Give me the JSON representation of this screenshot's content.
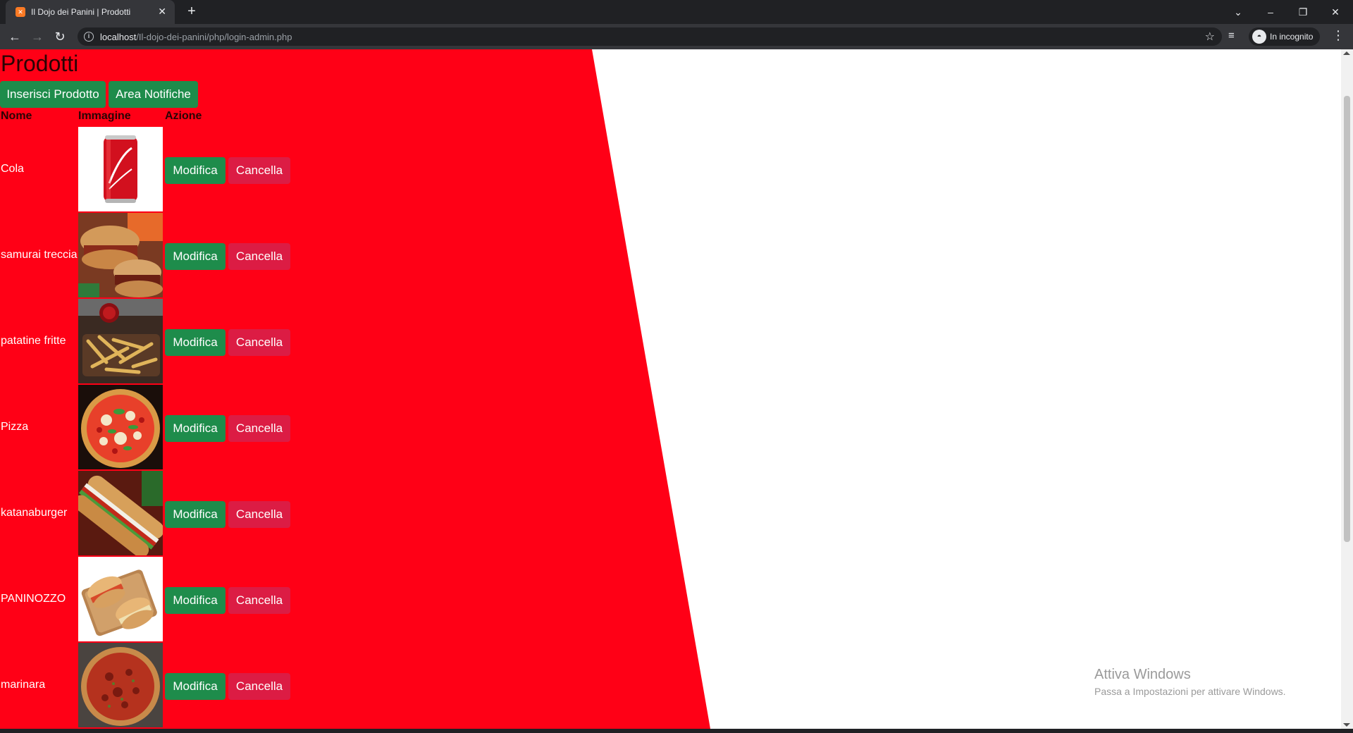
{
  "browser": {
    "tab_title": "Il Dojo dei Panini | Prodotti",
    "url_host": "localhost",
    "url_path": "/Il-dojo-dei-panini/php/login-admin.php",
    "incognito_label": "In incognito"
  },
  "page": {
    "title": "Prodotti",
    "buttons": {
      "insert": "Inserisci Prodotto",
      "notifications": "Area Notifiche"
    },
    "table": {
      "headers": [
        "Nome",
        "Immagine",
        "Azione"
      ],
      "edit_label": "Modifica",
      "delete_label": "Cancella",
      "rows": [
        {
          "name": "Cola",
          "image": "cola-can"
        },
        {
          "name": "samurai treccia",
          "image": "sandwich"
        },
        {
          "name": "patatine fritte",
          "image": "fries"
        },
        {
          "name": "Pizza",
          "image": "pizza"
        },
        {
          "name": "katanaburger",
          "image": "baguette"
        },
        {
          "name": "PANINOZZO",
          "image": "panino"
        },
        {
          "name": "marinara",
          "image": "pizza-marinara"
        }
      ]
    }
  },
  "watermark": {
    "title": "Attiva Windows",
    "subtitle": "Passa a Impostazioni per attivare Windows."
  },
  "colors": {
    "background_red": "#ff0016",
    "edit_green": "#1e8c4b",
    "delete_pink": "#dc1c44"
  }
}
